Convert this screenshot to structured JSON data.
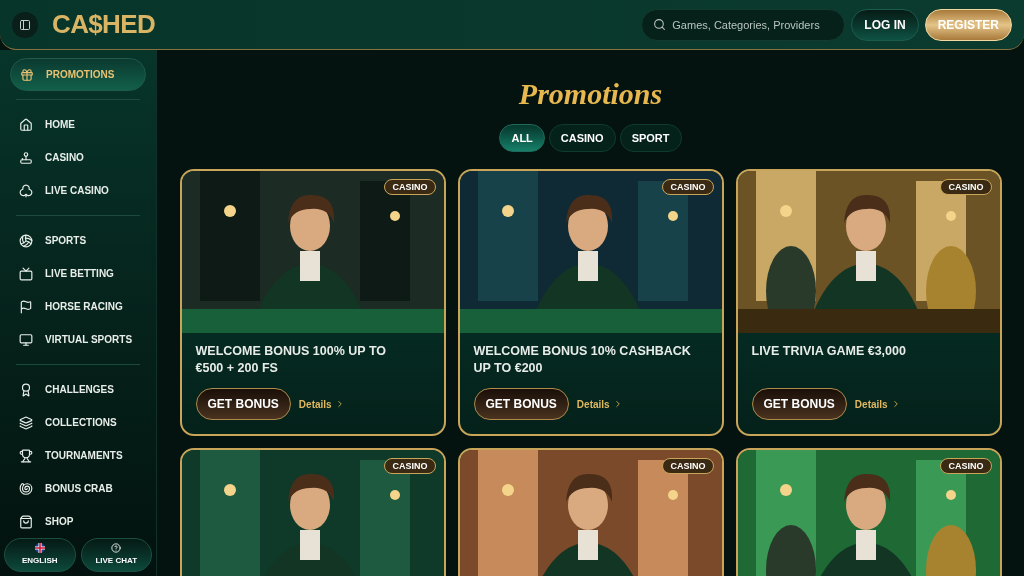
{
  "header": {
    "logo": "CA$HED",
    "search": {
      "placeholder": "Games, Categories, Providers"
    },
    "buttons": [
      {
        "label": "LOG IN",
        "kind": "outline"
      },
      {
        "label": "REGISTER",
        "kind": "gold"
      }
    ]
  },
  "sidebar": {
    "groups": [
      [
        {
          "label": "PROMOTIONS",
          "selected": true
        }
      ],
      [
        {
          "label": "HOME",
          "selected": false
        },
        {
          "label": "CASINO",
          "selected": false
        },
        {
          "label": "LIVE CASINO",
          "selected": false
        }
      ],
      [
        {
          "label": "SPORTS",
          "selected": false
        },
        {
          "label": "LIVE BETTING",
          "selected": false
        },
        {
          "label": "HORSE RACING",
          "selected": false
        },
        {
          "label": "VIRTUAL SPORTS",
          "selected": false
        }
      ],
      [
        {
          "label": "CHALLENGES",
          "selected": false
        },
        {
          "label": "COLLECTIONS",
          "selected": false
        },
        {
          "label": "TOURNAMENTS",
          "selected": false
        },
        {
          "label": "BONUS CRAB",
          "selected": false
        },
        {
          "label": "SHOP",
          "selected": false
        }
      ]
    ],
    "footer": [
      {
        "label": "ENGLISH",
        "kind": "language"
      },
      {
        "label": "LIVE CHAT",
        "kind": "chat"
      }
    ]
  },
  "page": {
    "title": "Promotions",
    "filters": [
      {
        "label": "ALL",
        "selected": true
      },
      {
        "label": "CASINO",
        "selected": false
      },
      {
        "label": "SPORT",
        "selected": false
      }
    ]
  },
  "promotions": [
    {
      "tag": "CASINO",
      "title": "WELCOME BONUS 100% UP TO €500 + 200 FS",
      "button": "GET BONUS",
      "link": "Details"
    },
    {
      "tag": "CASINO",
      "title": "WELCOME BONUS 10% CASHBACK UP TO €200",
      "button": "GET BONUS",
      "link": "Details"
    },
    {
      "tag": "CASINO",
      "title": "LIVE TRIVIA GAME €3,000",
      "button": "GET BONUS",
      "link": "Details"
    },
    {
      "tag": "CASINO"
    },
    {
      "tag": "CASINO"
    },
    {
      "tag": "CASINO"
    }
  ]
}
